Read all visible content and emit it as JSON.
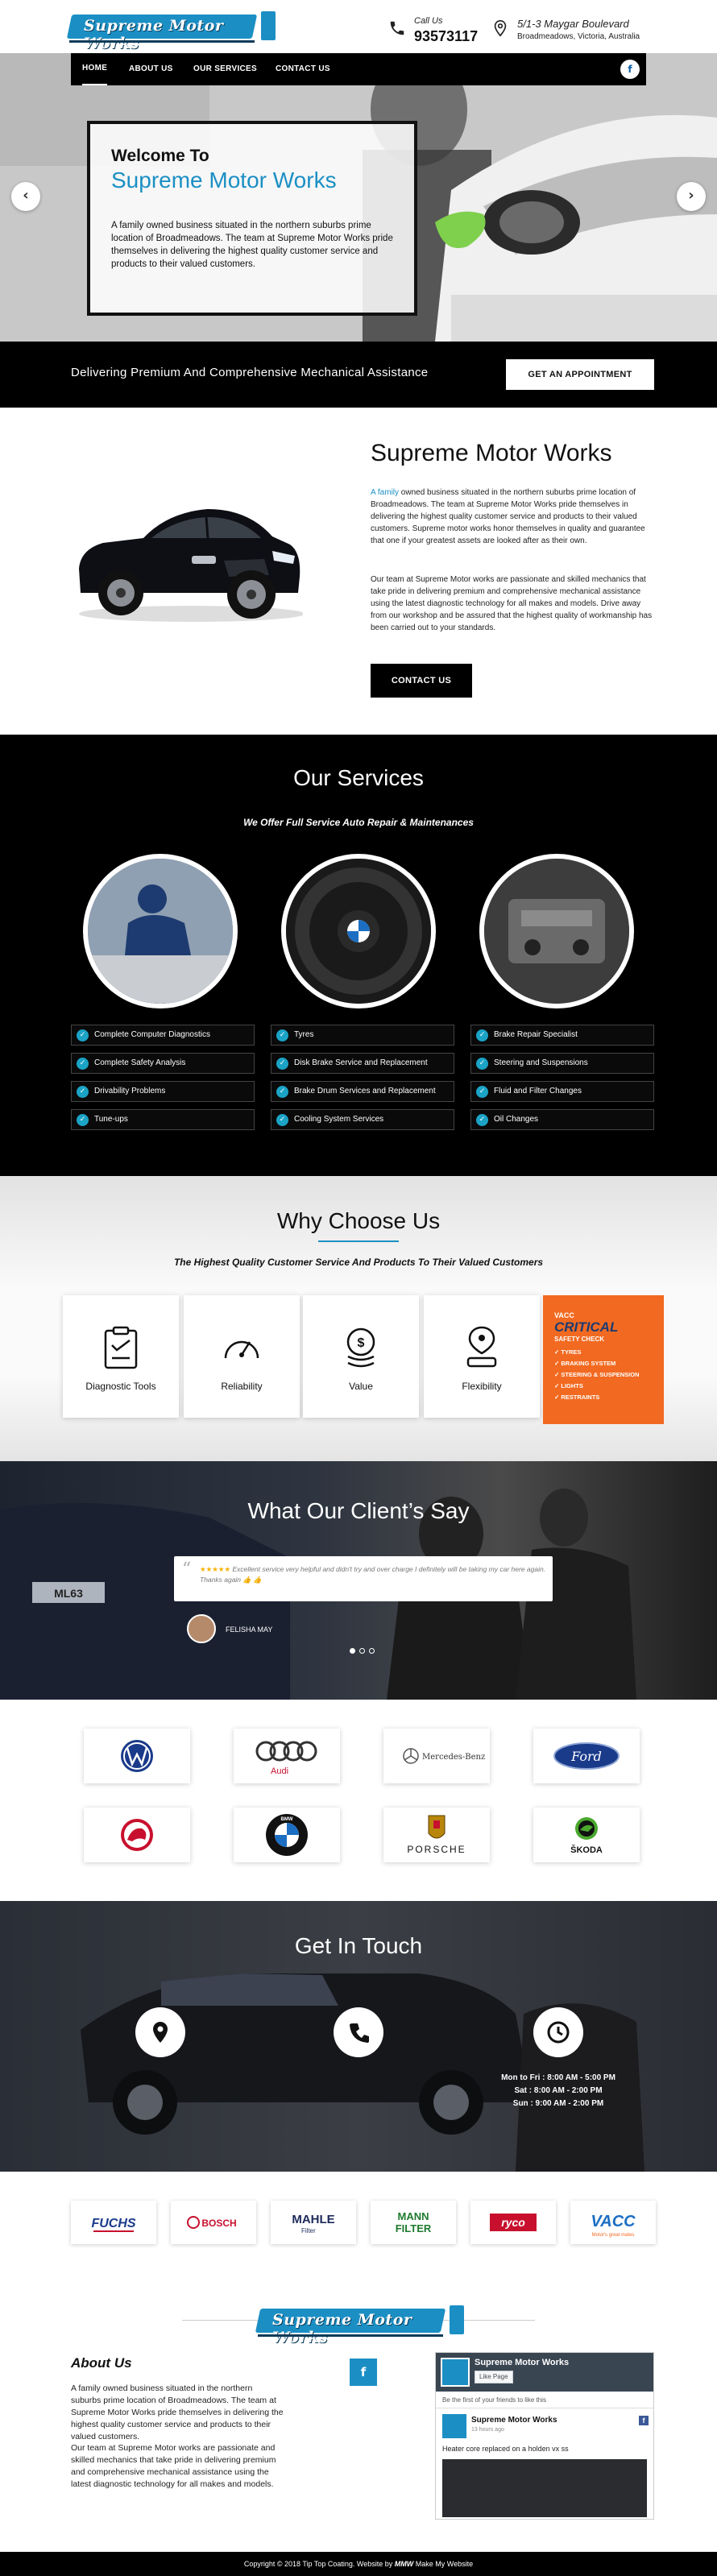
{
  "header": {
    "logo_text": "Supreme Motor Works",
    "call_label": "Call Us",
    "phone": "93573117",
    "address_line1": "5/1-3 Maygar Boulevard",
    "address_line2": "Broadmeadows, Victoria, Australia"
  },
  "nav": {
    "items": [
      "HOME",
      "ABOUT US",
      "OUR SERVICES",
      "CONTACT US"
    ],
    "active": "HOME",
    "facebook": "f"
  },
  "hero": {
    "welcome": "Welcome To",
    "brand": "Supreme Motor Works",
    "text": "A family owned business situated in the northern suburbs prime location of Broadmeadows. The team at Supreme Motor Works pride themselves in delivering the highest quality customer service and products to their valued customers.",
    "prev": "‹",
    "next": "›"
  },
  "deliver": {
    "text": "Delivering Premium And Comprehensive Mechanical Assistance",
    "button": "GET AN APPOINTMENT"
  },
  "about": {
    "title": "Supreme Motor Works",
    "p1_lead": "A family",
    "p1": " owned business situated in the northern suburbs prime location of Broadmeadows. The team at Supreme Motor Works pride themselves in delivering the highest quality customer service and products to their valued customers. Supreme motor works honor themselves in quality and guarantee that one if your greatest assets are looked after as their own.",
    "p2": "Our team at Supreme Motor works are passionate and skilled mechanics that take pride in delivering premium and comprehensive mechanical assistance using the latest diagnostic technology for all makes and models. Drive away from our workshop and be assured that the highest quality of workmanship has been carried out to your standards.",
    "button": "CONTACT US"
  },
  "services": {
    "title": "Our Services",
    "subtitle": "We Offer Full Service Auto Repair & Maintenances",
    "col1": [
      "Complete Computer Diagnostics",
      "Complete Safety Analysis",
      "Drivability Problems",
      "Tune-ups"
    ],
    "col2": [
      "Tyres",
      "Disk Brake Service and Replacement",
      "Brake Drum Services and Replacement",
      "Cooling System Services"
    ],
    "col3": [
      "Brake Repair Specialist",
      "Steering and Suspensions",
      "Fluid and Filter Changes",
      "Oil Changes"
    ],
    "check": "✓"
  },
  "why": {
    "title": "Why Choose Us",
    "subtitle": "The Highest Quality Customer Service And Products To Their Valued Customers",
    "cards": [
      "Diagnostic Tools",
      "Reliability",
      "Value",
      "Flexibility"
    ],
    "vacc": {
      "vacc": "VACC",
      "critical": "CRITICAL",
      "safety": "SAFETY CHECK",
      "items": [
        "TYRES",
        "BRAKING SYSTEM",
        "STEERING & SUSPENSION",
        "LIGHTS",
        "RESTRAINTS"
      ]
    }
  },
  "clients": {
    "title": "What Our Client’s Say",
    "stars": "★★★★★",
    "quote": "Excellent service very helpful and didn't try and over charge I definitely will be taking my car here again. Thanks again 👍 👍",
    "name": "FELISHA MAY",
    "car_plate": "ML63"
  },
  "brands": {
    "row1": [
      "Volkswagen",
      "Audi",
      "Mercedes-Benz",
      "Ford"
    ],
    "row2": [
      "Holden",
      "BMW",
      "PORSCHE",
      "ŠKODA"
    ],
    "audi_text": "Audi",
    "mercedes_text": "Mercedes-Benz",
    "ford_text": "Ford",
    "bmw_text": "BMW",
    "porsche_text": "PORSCHE",
    "skoda_text": "ŠKODA"
  },
  "touch": {
    "title": "Get In Touch",
    "hours": [
      "Mon to Fri : 8:00 AM - 5:00 PM",
      "Sat : 8:00 AM - 2:00 PM",
      "Sun : 9:00 AM - 2:00 PM"
    ]
  },
  "partners": [
    "FUCHS",
    "BOSCH",
    "MAHLE",
    "MANN FILTER",
    "ryco",
    "VACC"
  ],
  "partners_sub": {
    "mahle": "Filter",
    "mann1": "MANN",
    "mann2": "FILTER",
    "vacc": "Motor's great mates"
  },
  "footer": {
    "about_title": "About Us",
    "about_p1": "A family owned business situated in the northern suburbs prime location of Broadmeadows. The team at Supreme Motor Works pride themselves in delivering the highest quality customer service and products to their valued customers.",
    "about_p2": "Our team at Supreme Motor works are passionate and skilled mechanics that take pride in delivering premium and comprehensive mechanical assistance using the latest diagnostic technology for all makes and models.",
    "facebook": "f",
    "fb_page_name": "Supreme Motor Works",
    "fb_like": "Like Page",
    "fb_friends": "Be the first of your friends to like this",
    "fb_post_name": "Supreme Motor Works",
    "fb_post_time": "13 hours ago",
    "fb_post_text": "Heater core replaced on a holden vx ss"
  },
  "copyright": {
    "text": "Copyright © 2018 Tip Top Coating. Website by",
    "mmw": "MMW",
    "maker": "Make My Website"
  },
  "colors": {
    "accent": "#1b8fc4",
    "black": "#000000",
    "vacc_orange": "#f26a21"
  }
}
